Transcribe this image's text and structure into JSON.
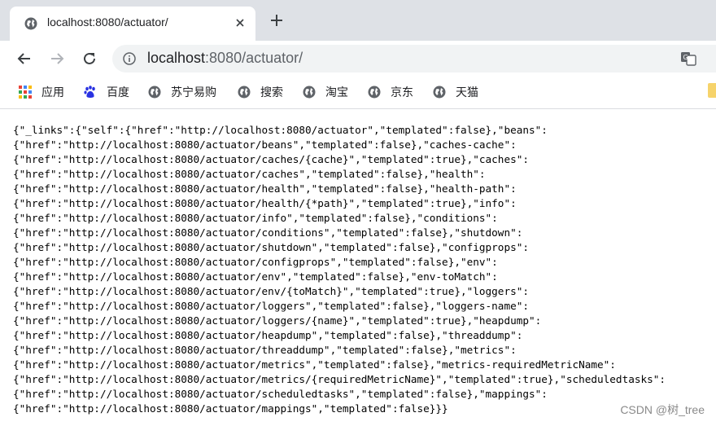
{
  "tab": {
    "title": "localhost:8080/actuator/",
    "favicon": "globe-icon"
  },
  "toolbar": {
    "url_host": "localhost",
    "url_rest": ":8080/actuator/"
  },
  "bookmarks": [
    {
      "label": "应用",
      "icon": "apps-grid-icon"
    },
    {
      "label": "百度",
      "icon": "baidu-paw-icon"
    },
    {
      "label": "苏宁易购",
      "icon": "globe-icon"
    },
    {
      "label": "搜索",
      "icon": "globe-icon"
    },
    {
      "label": "淘宝",
      "icon": "globe-icon"
    },
    {
      "label": "京东",
      "icon": "globe-icon"
    },
    {
      "label": "天猫",
      "icon": "globe-icon"
    }
  ],
  "content": {
    "json_text": "{\"_links\":{\"self\":{\"href\":\"http://localhost:8080/actuator\",\"templated\":false},\"beans\":\n{\"href\":\"http://localhost:8080/actuator/beans\",\"templated\":false},\"caches-cache\":\n{\"href\":\"http://localhost:8080/actuator/caches/{cache}\",\"templated\":true},\"caches\":\n{\"href\":\"http://localhost:8080/actuator/caches\",\"templated\":false},\"health\":\n{\"href\":\"http://localhost:8080/actuator/health\",\"templated\":false},\"health-path\":\n{\"href\":\"http://localhost:8080/actuator/health/{*path}\",\"templated\":true},\"info\":\n{\"href\":\"http://localhost:8080/actuator/info\",\"templated\":false},\"conditions\":\n{\"href\":\"http://localhost:8080/actuator/conditions\",\"templated\":false},\"shutdown\":\n{\"href\":\"http://localhost:8080/actuator/shutdown\",\"templated\":false},\"configprops\":\n{\"href\":\"http://localhost:8080/actuator/configprops\",\"templated\":false},\"env\":\n{\"href\":\"http://localhost:8080/actuator/env\",\"templated\":false},\"env-toMatch\":\n{\"href\":\"http://localhost:8080/actuator/env/{toMatch}\",\"templated\":true},\"loggers\":\n{\"href\":\"http://localhost:8080/actuator/loggers\",\"templated\":false},\"loggers-name\":\n{\"href\":\"http://localhost:8080/actuator/loggers/{name}\",\"templated\":true},\"heapdump\":\n{\"href\":\"http://localhost:8080/actuator/heapdump\",\"templated\":false},\"threaddump\":\n{\"href\":\"http://localhost:8080/actuator/threaddump\",\"templated\":false},\"metrics\":\n{\"href\":\"http://localhost:8080/actuator/metrics\",\"templated\":false},\"metrics-requiredMetricName\":\n{\"href\":\"http://localhost:8080/actuator/metrics/{requiredMetricName}\",\"templated\":true},\"scheduledtasks\":\n{\"href\":\"http://localhost:8080/actuator/scheduledtasks\",\"templated\":false},\"mappings\":\n{\"href\":\"http://localhost:8080/actuator/mappings\",\"templated\":false}}}"
  },
  "watermark": "CSDN @树_tree"
}
